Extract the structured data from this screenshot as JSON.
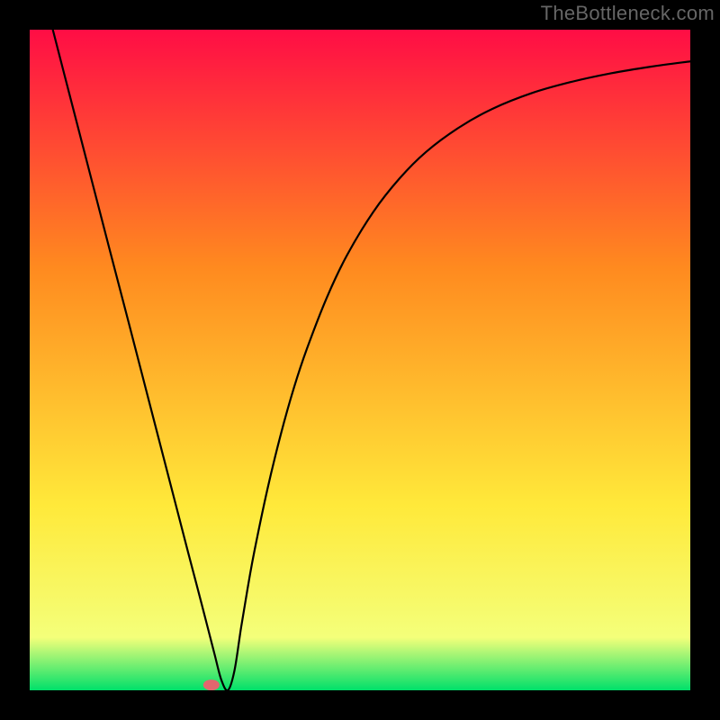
{
  "watermark": "TheBottleneck.com",
  "chart_data": {
    "type": "line",
    "title": "",
    "xlabel": "",
    "ylabel": "",
    "x_range": [
      0,
      100
    ],
    "y_range": [
      0,
      100
    ],
    "gradient_background": {
      "top_color": "#ff0d45",
      "mid_upper_color": "#ff8a1f",
      "mid_lower_color": "#ffe93a",
      "bottom_color": "#00e06a"
    },
    "series": [
      {
        "name": "curve",
        "stroke": "#000000",
        "stroke_width": 2.2,
        "x": [
          3.5,
          6,
          9,
          12,
          15,
          18,
          21,
          24,
          25.5,
          27,
          28,
          29,
          30,
          31,
          32,
          33,
          34,
          36,
          38,
          40,
          42,
          45,
          48,
          52,
          56,
          60,
          65,
          70,
          76,
          82,
          88,
          94,
          100
        ],
        "y": [
          100,
          90.3,
          78.7,
          67.1,
          55.6,
          44.0,
          32.4,
          20.8,
          15.1,
          9.3,
          5.4,
          1.6,
          0.0,
          3.0,
          9.5,
          15.5,
          21.0,
          30.5,
          38.7,
          45.8,
          51.8,
          59.5,
          65.8,
          72.4,
          77.5,
          81.5,
          85.2,
          88.0,
          90.4,
          92.1,
          93.4,
          94.4,
          95.2
        ]
      }
    ],
    "marker": {
      "name": "bottleneck-point",
      "x": 27.5,
      "y": 0.8,
      "fill": "#e2666e",
      "rx": 9,
      "ry": 6
    }
  }
}
